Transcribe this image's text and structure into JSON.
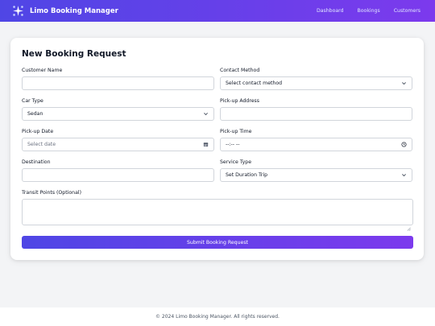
{
  "brand": {
    "name": "Limo Booking Manager",
    "logo_icon": "sparkle-logo-icon"
  },
  "nav": {
    "links": [
      "Dashboard",
      "Bookings",
      "Customers"
    ]
  },
  "form": {
    "title": "New Booking Request",
    "customer_name": {
      "label": "Customer Name",
      "value": ""
    },
    "contact_method": {
      "label": "Contact Method",
      "value": "Select contact method"
    },
    "car_type": {
      "label": "Car Type",
      "value": "Sedan"
    },
    "pickup_address": {
      "label": "Pick-up Address",
      "value": ""
    },
    "pickup_date": {
      "label": "Pick-up Date",
      "placeholder": "Select date",
      "icon": "calendar-icon"
    },
    "pickup_time": {
      "label": "Pick-up Time",
      "value": "--:-- --",
      "icon": "clock-icon"
    },
    "destination": {
      "label": "Destination",
      "value": ""
    },
    "service_type": {
      "label": "Service Type",
      "value": "Set Duration Trip"
    },
    "transit_points": {
      "label": "Transit Points (Optional)",
      "value": ""
    },
    "submit_label": "Submit Booking Request"
  },
  "footer": {
    "text": "© 2024 Limo Booking Manager. All rights reserved."
  },
  "colors": {
    "gradient_start": "#4f46e5",
    "gradient_end": "#7c3aed",
    "page_bg": "#f3f4f6"
  }
}
